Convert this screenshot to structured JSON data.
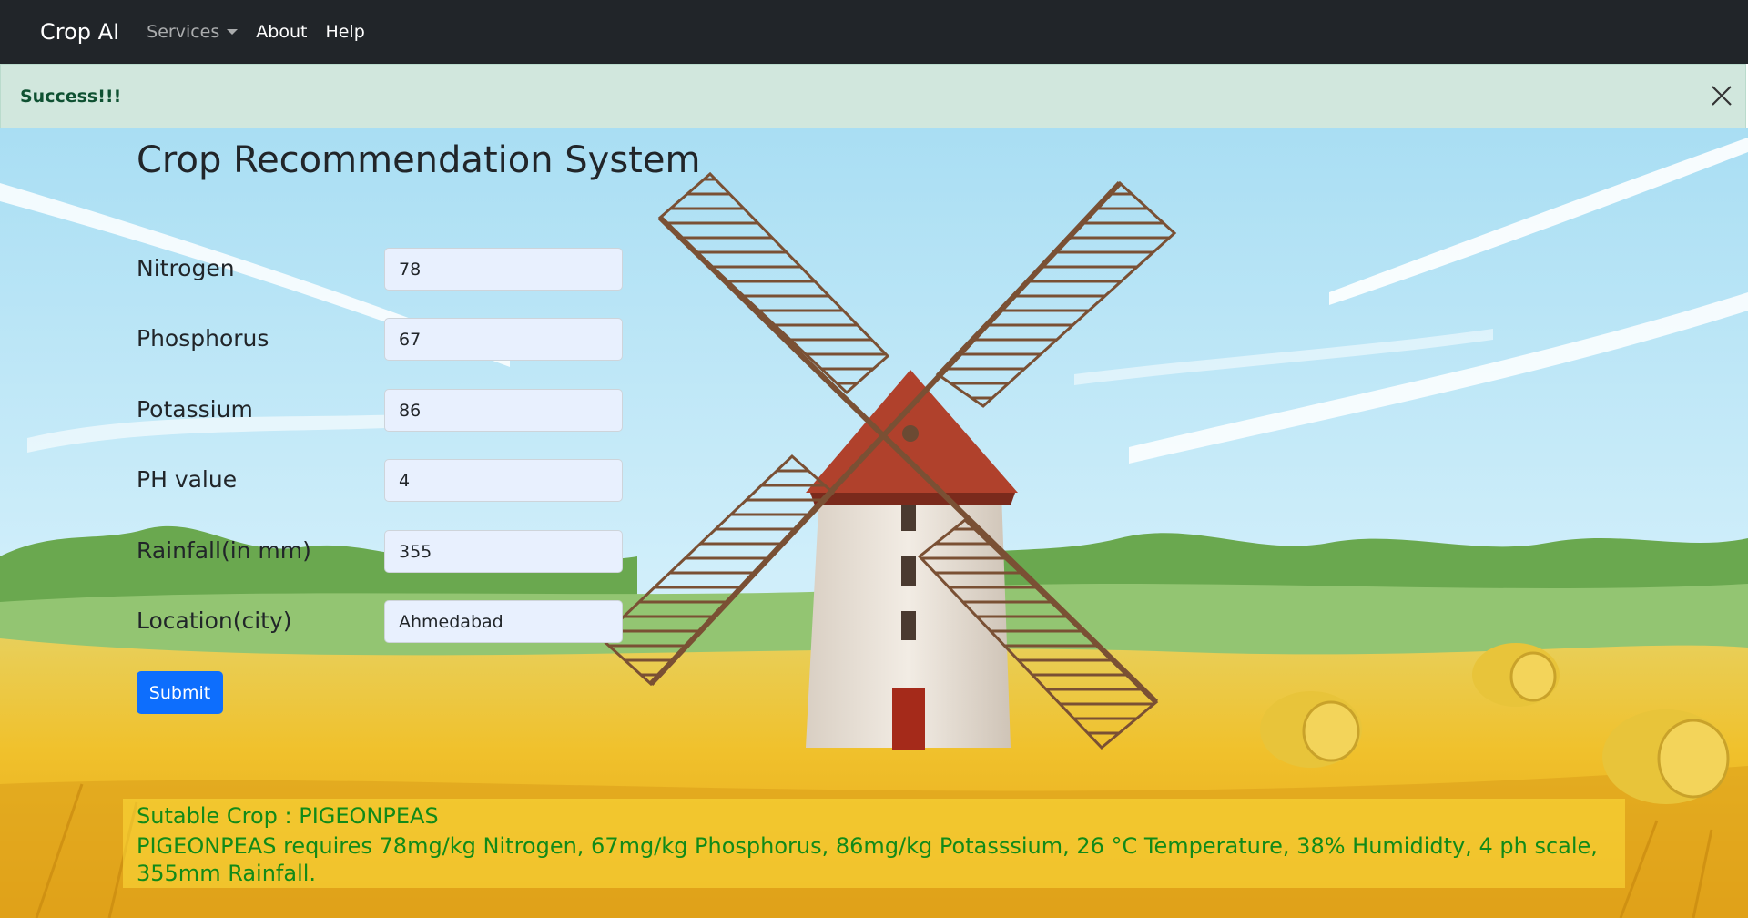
{
  "navbar": {
    "brand": "Crop AI",
    "links": [
      {
        "label": "Services"
      },
      {
        "label": "About"
      },
      {
        "label": "Help"
      }
    ]
  },
  "alert": {
    "message": "Success!!!"
  },
  "page": {
    "title": "Crop Recommendation System"
  },
  "form": {
    "fields": [
      {
        "label": "Nitrogen",
        "value": "78"
      },
      {
        "label": "Phosphorus",
        "value": "67"
      },
      {
        "label": "Potassium",
        "value": "86"
      },
      {
        "label": "PH value",
        "value": "4"
      },
      {
        "label": "Rainfall(in mm)",
        "value": "355"
      },
      {
        "label": "Location(city)",
        "value": "Ahmedabad"
      }
    ],
    "submit_label": "Submit"
  },
  "result": {
    "title": "Sutable Crop : PIGEONPEAS",
    "description": "PIGEONPEAS requires 78mg/kg Nitrogen, 67mg/kg Phosphorus, 86mg/kg Potasssium, 26 °C Temperature, 38% Humididty, 4 ph scale, 355mm Rainfall."
  },
  "colors": {
    "navbar_bg": "#212529",
    "alert_bg": "#d1e7dd",
    "alert_text": "#0f5132",
    "primary_button": "#0d6efd",
    "result_text": "#118a18"
  }
}
